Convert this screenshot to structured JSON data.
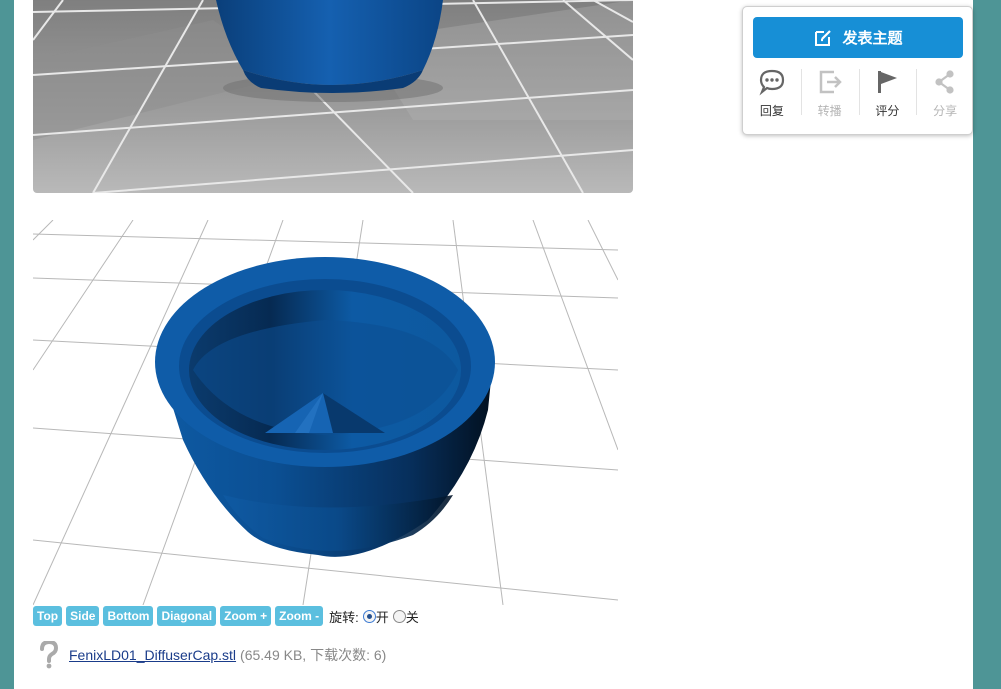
{
  "viewer_controls": {
    "buttons": [
      "Top",
      "Side",
      "Bottom",
      "Diagonal",
      "Zoom +",
      "Zoom -"
    ],
    "rotate_label": "旋转:",
    "on_label": "开",
    "off_label": "关",
    "rotate_on": true
  },
  "attachment": {
    "filename": "FenixLD01_DiffuserCap.stl",
    "meta": "(65.49 KB, 下载次数: 6)",
    "icon": "question-mark-icon"
  },
  "action_box": {
    "post_button_label": "发表主题",
    "post_icon": "edit-icon",
    "actions": [
      {
        "label": "回复",
        "icon": "chat-bubble-icon",
        "enabled": true
      },
      {
        "label": "转播",
        "icon": "forward-icon",
        "enabled": false
      },
      {
        "label": "评分",
        "icon": "flag-icon",
        "enabled": true
      },
      {
        "label": "分享",
        "icon": "share-icon",
        "enabled": false
      }
    ]
  },
  "colors": {
    "page_background": "#4e9596",
    "model_blue": "#0d4f91",
    "button_blue": "#178fd6",
    "control_button": "#5bbfdf"
  }
}
